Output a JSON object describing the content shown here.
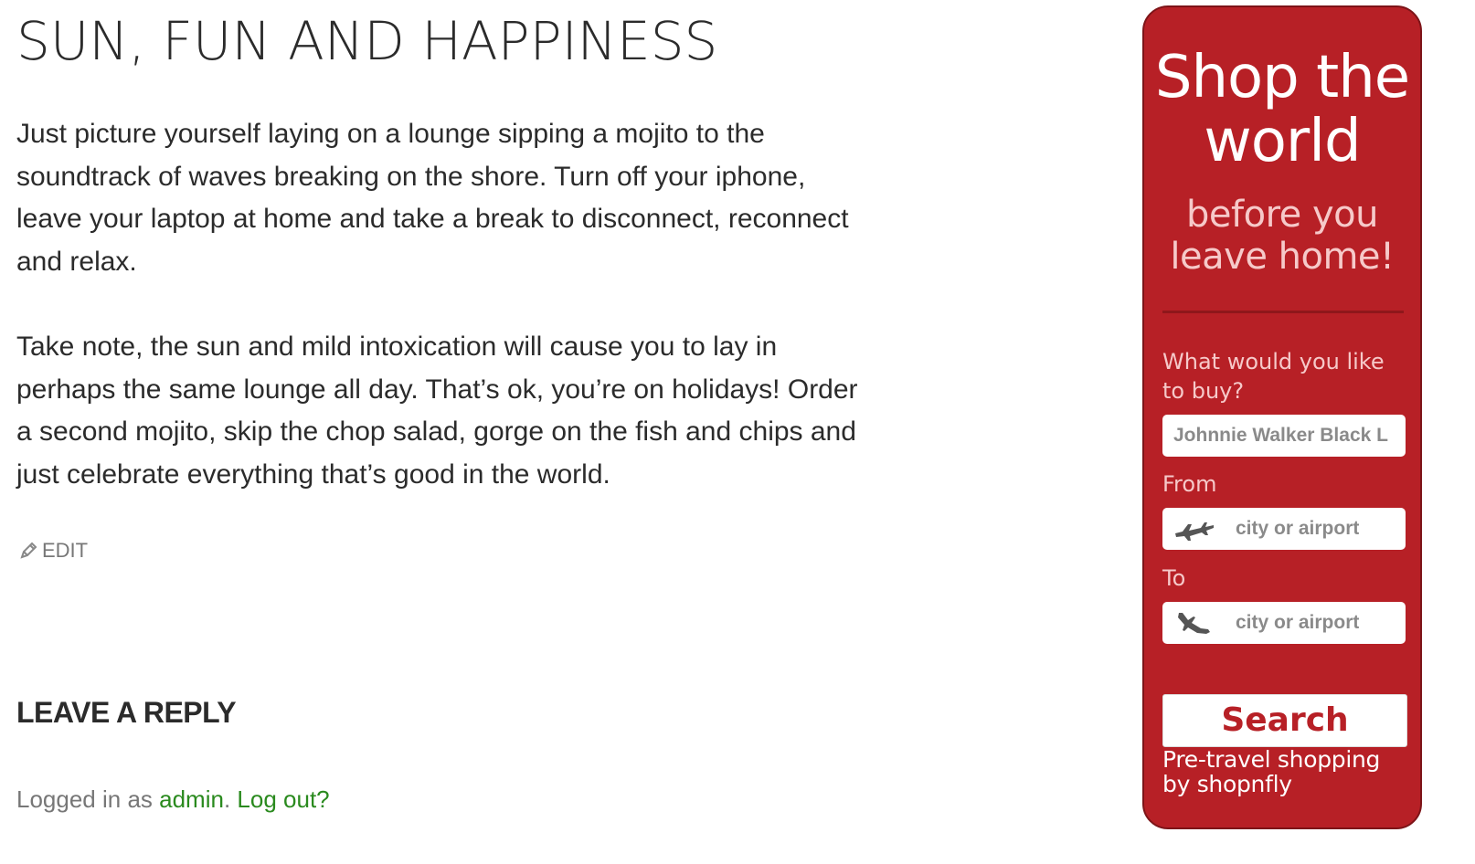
{
  "post": {
    "title": "SUN, FUN AND HAPPINESS",
    "paragraphs": [
      "Just picture yourself laying on a lounge sipping a mojito to the soundtrack of waves breaking on the shore. Turn off your iphone, leave your laptop at home and take a break to disconnect, reconnect and relax.",
      "Take note, the sun and mild intoxication will cause you to lay in perhaps the same lounge all day. That’s ok, you’re on holidays! Order a second mojito, skip the chop salad, gorge on the fish and chips and just celebrate everything that’s good in the world."
    ],
    "edit_label": "EDIT",
    "edit_icon": "pencil-icon"
  },
  "reply": {
    "title": "LEAVE A REPLY",
    "logged_prefix": "Logged in as ",
    "user": "admin",
    "separator": ". ",
    "logout": "Log out?"
  },
  "widget": {
    "title_line1": "Shop the",
    "title_line2": "world",
    "subtitle_line1": "before you",
    "subtitle_line2": "leave home!",
    "product_label": "What would you like to buy?",
    "product_value": "Johnnie Walker Black L",
    "from_label": "From",
    "from_placeholder": "city or airport",
    "from_icon": "plane-departure-icon",
    "to_label": "To",
    "to_placeholder": "city or airport",
    "to_icon": "plane-arrival-icon",
    "search_label": "Search",
    "footer_line1": "Pre-travel shopping",
    "footer_line2": "by shopnfly",
    "colors": {
      "background": "#b72026",
      "accent_text": "#f6c9c9",
      "button_text": "#b72026"
    }
  },
  "colors": {
    "link": "#2a8a1e",
    "muted": "#777777",
    "text": "#2b2b2b"
  }
}
